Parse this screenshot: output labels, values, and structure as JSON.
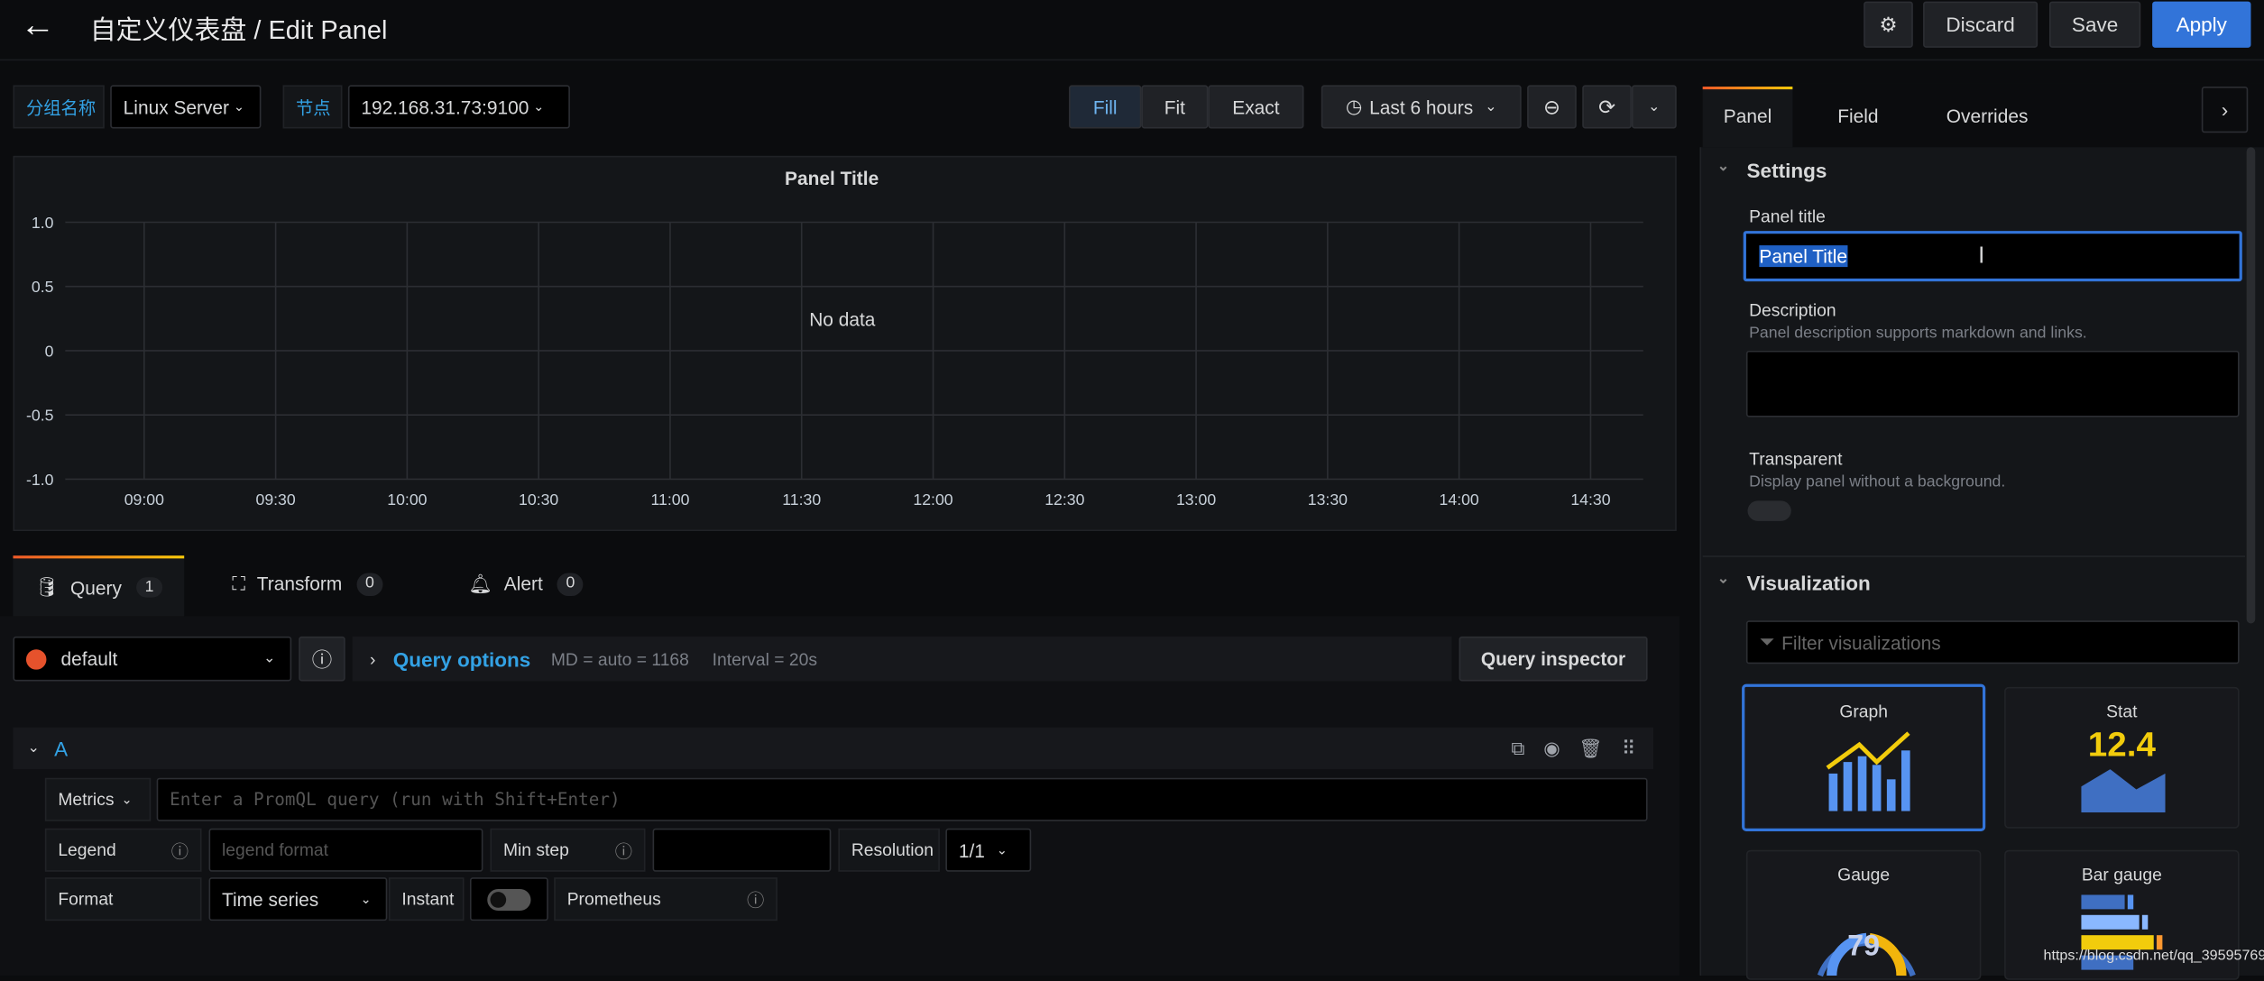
{
  "header": {
    "title": "自定义仪表盘 / Edit Panel",
    "discard": "Discard",
    "save": "Save",
    "apply": "Apply"
  },
  "variables": [
    {
      "label": "分组名称",
      "value": "Linux Server"
    },
    {
      "label": "节点",
      "value": "192.168.31.73:9100"
    }
  ],
  "toolbar": {
    "fill": "Fill",
    "fit": "Fit",
    "exact": "Exact",
    "time_range": "Last 6 hours"
  },
  "panel": {
    "title": "Panel Title",
    "no_data": "No data"
  },
  "chart_data": {
    "type": "line",
    "title": "Panel Title",
    "series": [],
    "y_ticks": [
      "1.0",
      "0.5",
      "0",
      "-0.5",
      "-1.0"
    ],
    "x_ticks": [
      "09:00",
      "09:30",
      "10:00",
      "10:30",
      "11:00",
      "11:30",
      "12:00",
      "12:30",
      "13:00",
      "13:30",
      "14:00",
      "14:30"
    ],
    "ylim": [
      -1,
      1
    ],
    "grid": true,
    "annotation": "No data"
  },
  "query_tabs": [
    {
      "label": "Query",
      "count": "1"
    },
    {
      "label": "Transform",
      "count": "0"
    },
    {
      "label": "Alert",
      "count": "0"
    }
  ],
  "datasource": {
    "name": "default",
    "query_options": "Query options",
    "md": "MD = auto = 1168",
    "interval": "Interval = 20s",
    "inspector": "Query inspector"
  },
  "query": {
    "ref": "A",
    "metrics": "Metrics",
    "placeholder": "Enter a PromQL query (run with Shift+Enter)",
    "legend": "Legend",
    "legend_placeholder": "legend format",
    "min_step": "Min step",
    "resolution": "Resolution",
    "resolution_value": "1/1",
    "format": "Format",
    "format_value": "Time series",
    "instant": "Instant",
    "prometheus": "Prometheus"
  },
  "options": {
    "tabs": [
      "Panel",
      "Field",
      "Overrides"
    ],
    "settings": "Settings",
    "panel_title_label": "Panel title",
    "panel_title_value": "Panel Title",
    "description": "Description",
    "description_hint": "Panel description supports markdown and links.",
    "transparent": "Transparent",
    "transparent_hint": "Display panel without a background.",
    "visualization": "Visualization",
    "filter_placeholder": "Filter visualizations",
    "viz": [
      "Graph",
      "Stat",
      "Gauge",
      "Bar gauge"
    ],
    "stat_value": "12.4",
    "gauge_value": "79"
  },
  "watermark": "https://blog.csdn.net/qq_39595769",
  "colors": {
    "accent": "#3274d9",
    "query_link": "#33a2e5",
    "yellow": "#f2cc0c",
    "orange": "#ff7d1f"
  }
}
